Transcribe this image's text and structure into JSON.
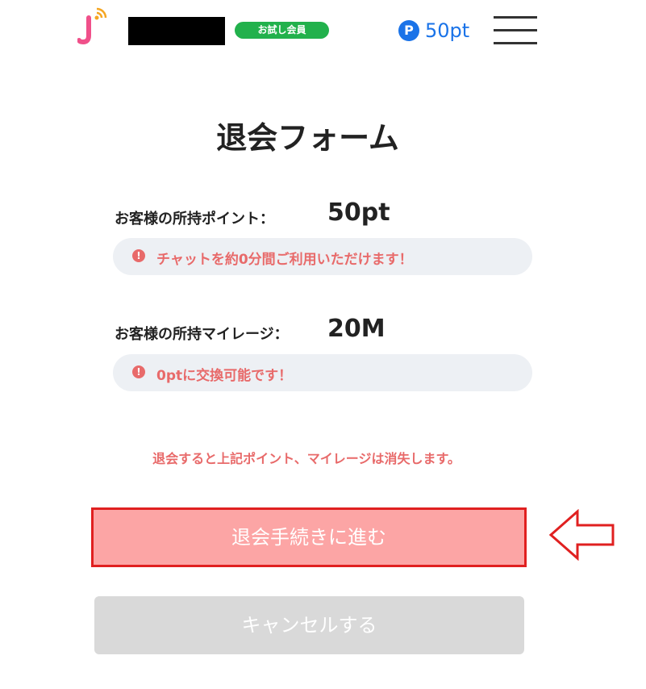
{
  "header": {
    "logo_icon": "j-wifi-logo-icon",
    "member_badge": "お試し会員",
    "points_icon_letter": "P",
    "points": "50pt",
    "menu_icon": "hamburger-menu-icon"
  },
  "page": {
    "title": "退会フォーム"
  },
  "points_info": {
    "label": "お客様の所持ポイント：",
    "value": "50pt",
    "notice_icon_mark": "!",
    "notice": "チャットを約0分間ご利用いただけます！"
  },
  "mileage_info": {
    "label": "お客様の所持マイレージ：",
    "value": "20M",
    "notice_icon_mark": "!",
    "notice": "0ptに交換可能です！"
  },
  "warning": "退会すると上記ポイント、マイレージは消失します。",
  "buttons": {
    "proceed": "退会手続きに進む",
    "cancel": "キャンセルする"
  },
  "colors": {
    "accent_blue": "#1a73e8",
    "badge_green": "#22b14c",
    "warning_red": "#e86a6a",
    "proceed_bg": "#fca5a5",
    "proceed_border": "#e02020",
    "cancel_bg": "#d9d9d9"
  }
}
